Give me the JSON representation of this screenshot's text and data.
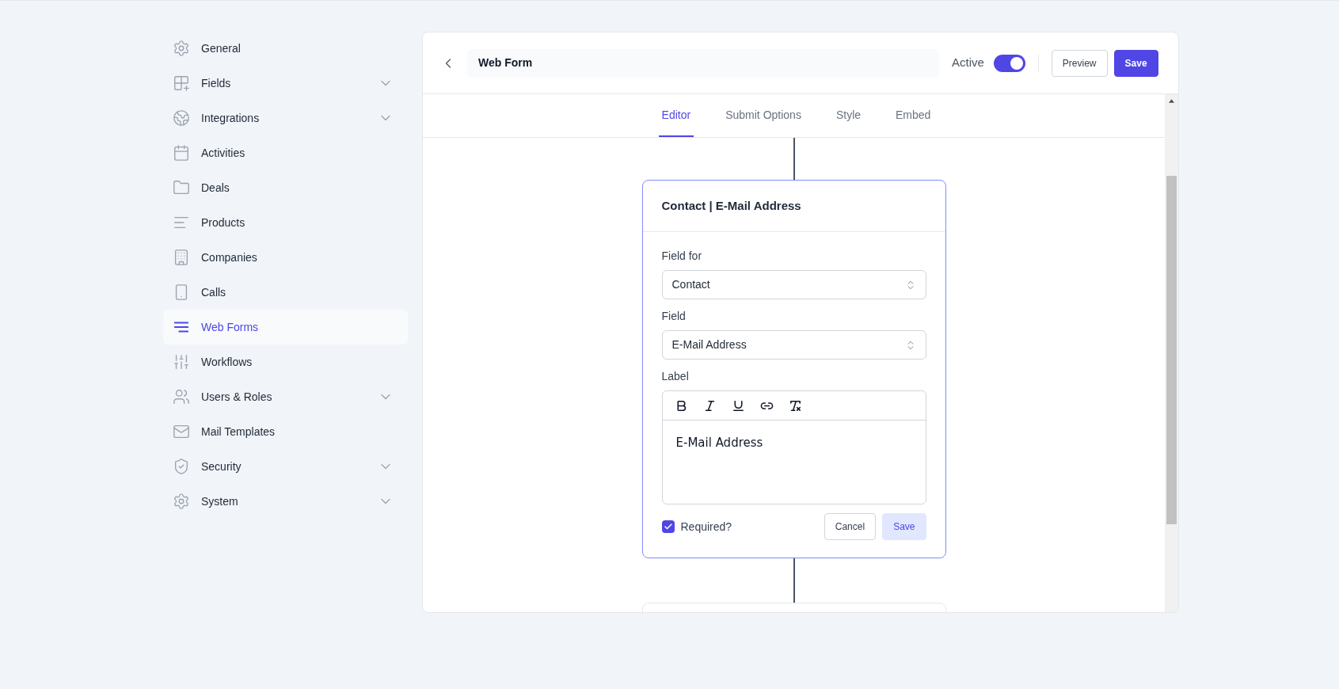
{
  "sidebar": {
    "items": [
      {
        "label": "General",
        "selected": false,
        "expandable": false
      },
      {
        "label": "Fields",
        "selected": false,
        "expandable": true
      },
      {
        "label": "Integrations",
        "selected": false,
        "expandable": true
      },
      {
        "label": "Activities",
        "selected": false,
        "expandable": false
      },
      {
        "label": "Deals",
        "selected": false,
        "expandable": false
      },
      {
        "label": "Products",
        "selected": false,
        "expandable": false
      },
      {
        "label": "Companies",
        "selected": false,
        "expandable": false
      },
      {
        "label": "Calls",
        "selected": false,
        "expandable": false
      },
      {
        "label": "Web Forms",
        "selected": true,
        "expandable": false
      },
      {
        "label": "Workflows",
        "selected": false,
        "expandable": false
      },
      {
        "label": "Users & Roles",
        "selected": false,
        "expandable": true
      },
      {
        "label": "Mail Templates",
        "selected": false,
        "expandable": false
      },
      {
        "label": "Security",
        "selected": false,
        "expandable": true
      },
      {
        "label": "System",
        "selected": false,
        "expandable": true
      }
    ]
  },
  "header": {
    "title": "Web Form",
    "active_label": "Active",
    "active": true,
    "buttons": [
      {
        "label": "Preview",
        "kind": "secondary"
      },
      {
        "label": "Save",
        "kind": "primary"
      }
    ]
  },
  "tabs": [
    {
      "label": "Editor",
      "selected": true
    },
    {
      "label": "Submit Options",
      "selected": false
    },
    {
      "label": "Style",
      "selected": false
    },
    {
      "label": "Embed",
      "selected": false
    }
  ],
  "field_card": {
    "title": "Contact | E-Mail Address",
    "selects": [
      {
        "label": "Field for",
        "value": "Contact"
      },
      {
        "label": "Field",
        "value": "E-Mail Address"
      }
    ],
    "label_field": {
      "label": "Label",
      "value": "E-Mail Address"
    },
    "required": {
      "label": "Required?",
      "checked": true
    },
    "buttons": [
      {
        "label": "Cancel",
        "kind": "secondary"
      },
      {
        "label": "Save",
        "kind": "soft"
      }
    ]
  }
}
